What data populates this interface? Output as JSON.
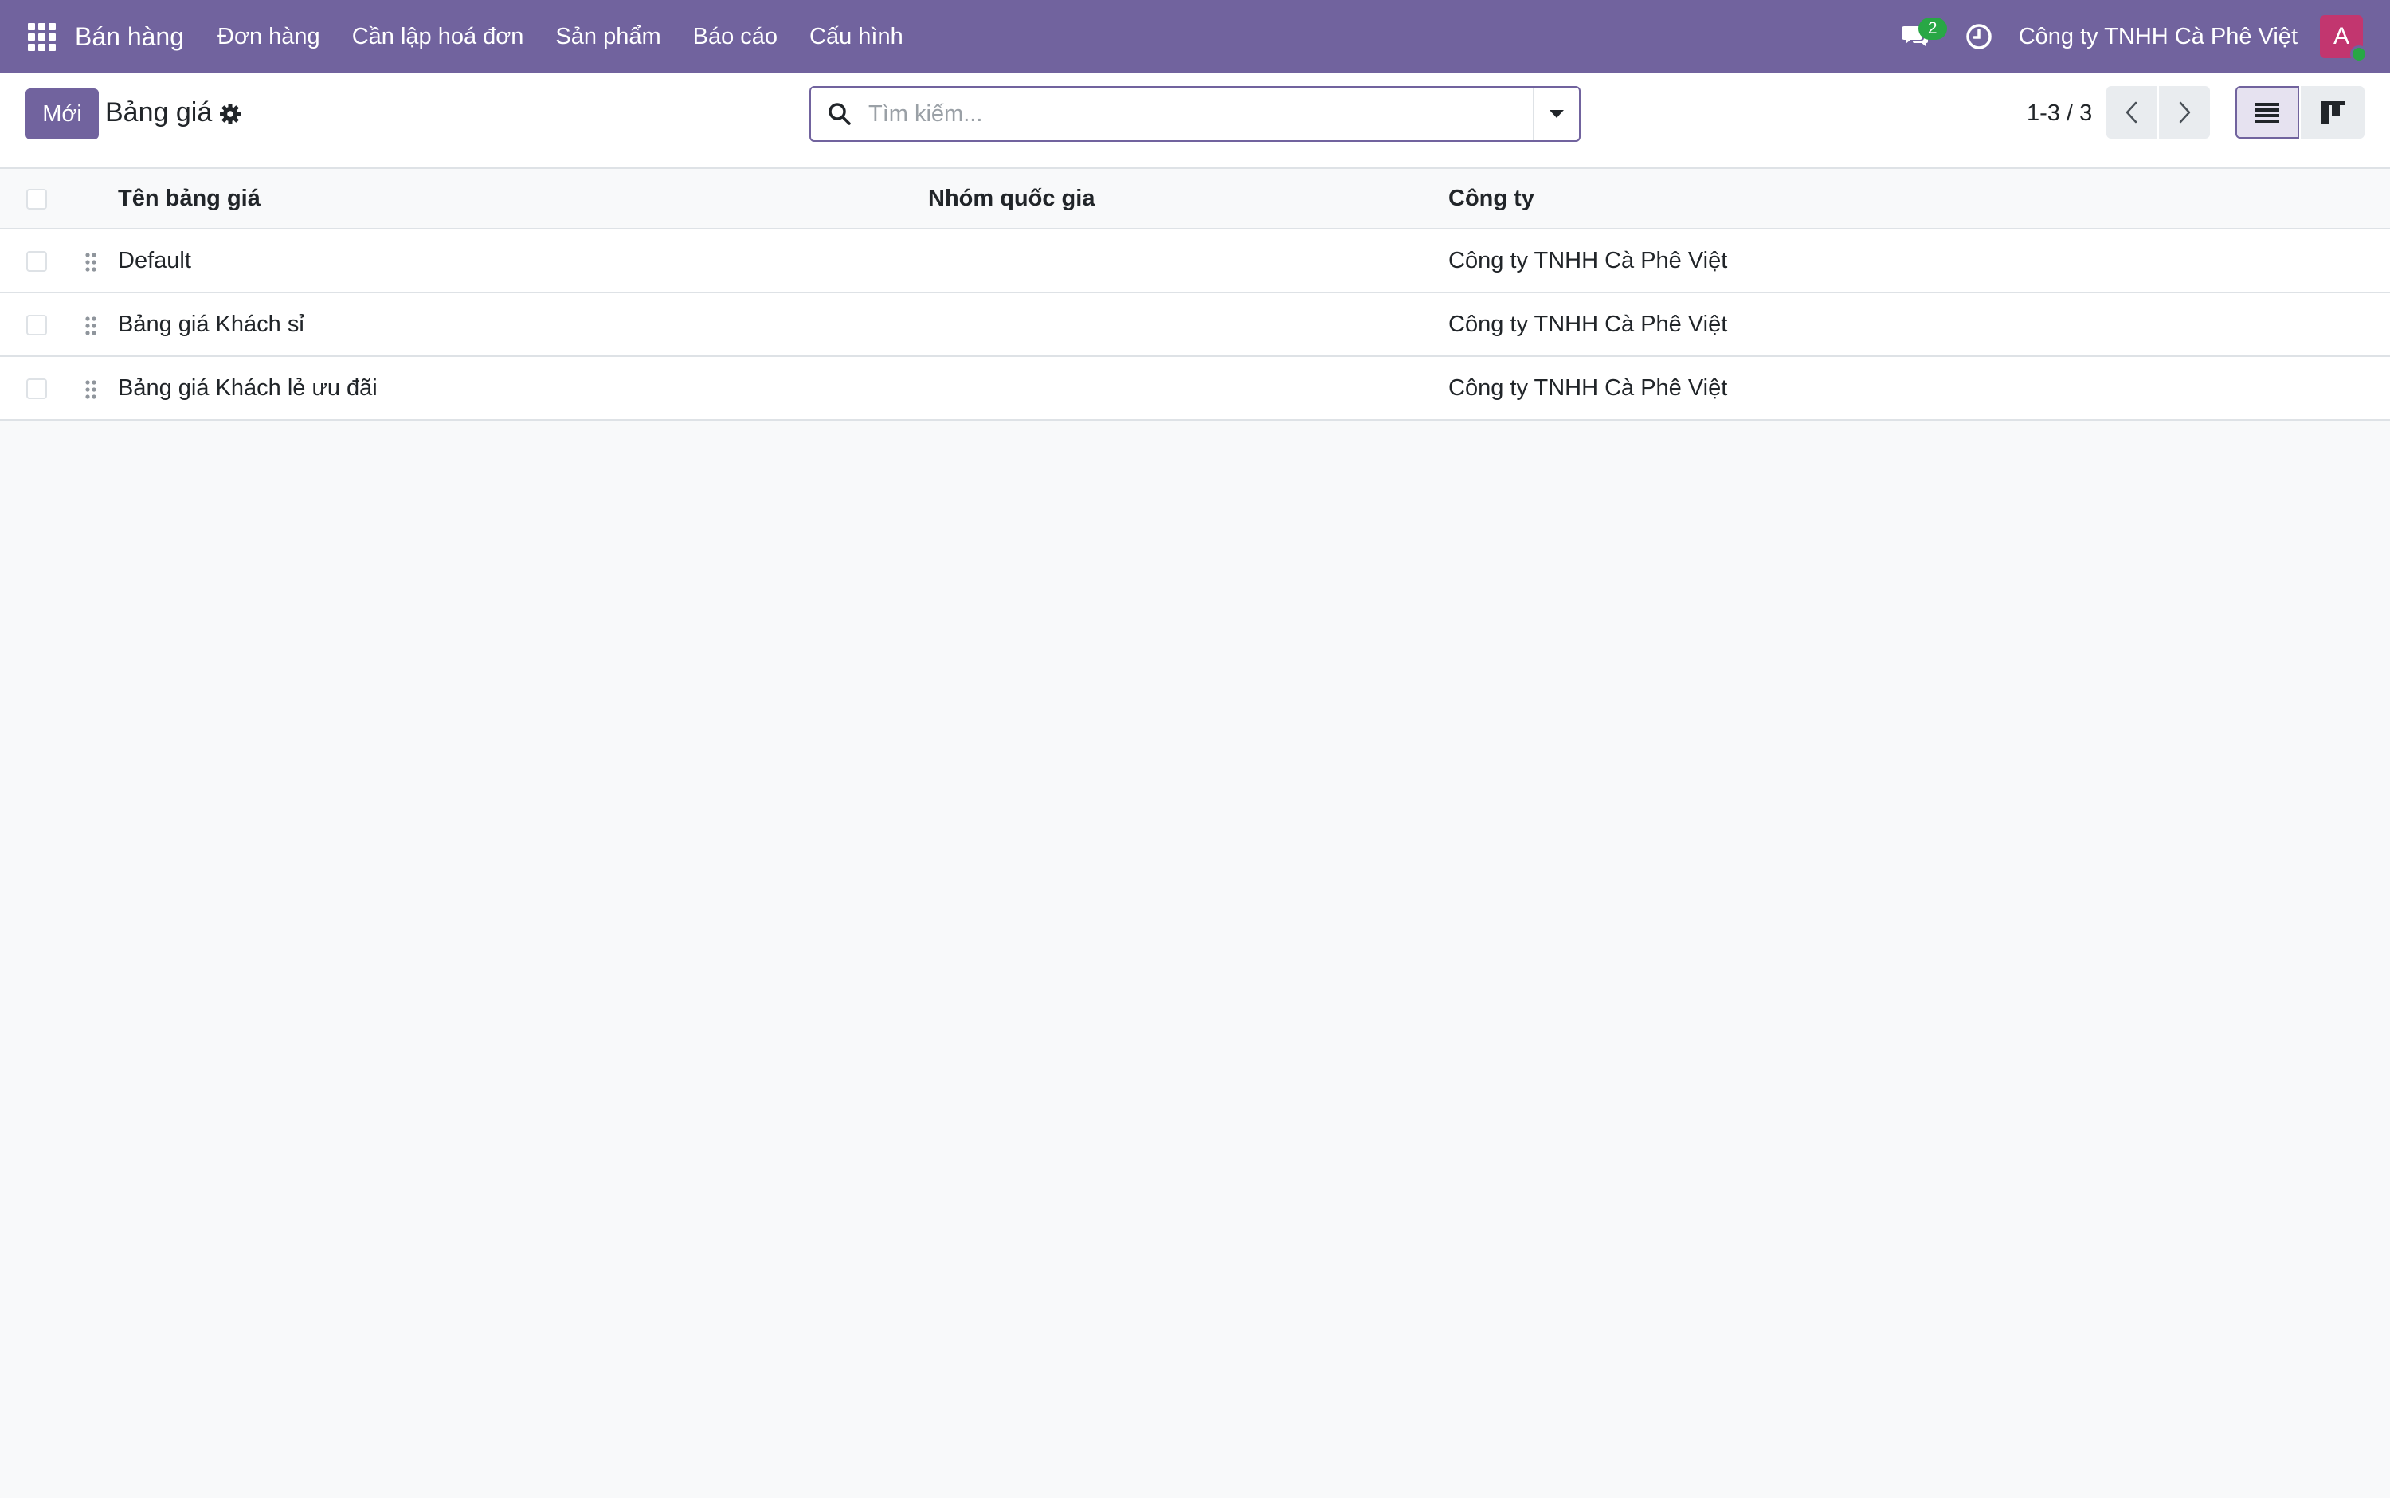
{
  "navbar": {
    "app_title": "Bán hàng",
    "menu": [
      "Đơn hàng",
      "Cần lập hoá đơn",
      "Sản phẩm",
      "Báo cáo",
      "Cấu hình"
    ],
    "chat_count": "2",
    "company": "Công ty TNHH Cà Phê Việt",
    "avatar_letter": "A",
    "colors": {
      "brand": "#71639e",
      "badge": "#28a745",
      "avatar": "#c2366f"
    },
    "icons": [
      "apps-grid-icon",
      "chat-icon",
      "clock-icon"
    ]
  },
  "control_panel": {
    "new_label": "Mới",
    "title": "Bảng giá",
    "search_placeholder": "Tìm kiếm...",
    "pager": "1-3 / 3",
    "views": [
      "list",
      "kanban"
    ],
    "active_view": "list"
  },
  "table": {
    "columns": [
      "Tên bảng giá",
      "Nhóm quốc gia",
      "Công ty"
    ],
    "rows": [
      {
        "name": "Default",
        "country_group": "",
        "company": "Công ty TNHH Cà Phê Việt"
      },
      {
        "name": "Bảng giá Khách sỉ",
        "country_group": "",
        "company": "Công ty TNHH Cà Phê Việt"
      },
      {
        "name": "Bảng giá Khách lẻ ưu đãi",
        "country_group": "",
        "company": "Công ty TNHH Cà Phê Việt"
      }
    ]
  }
}
